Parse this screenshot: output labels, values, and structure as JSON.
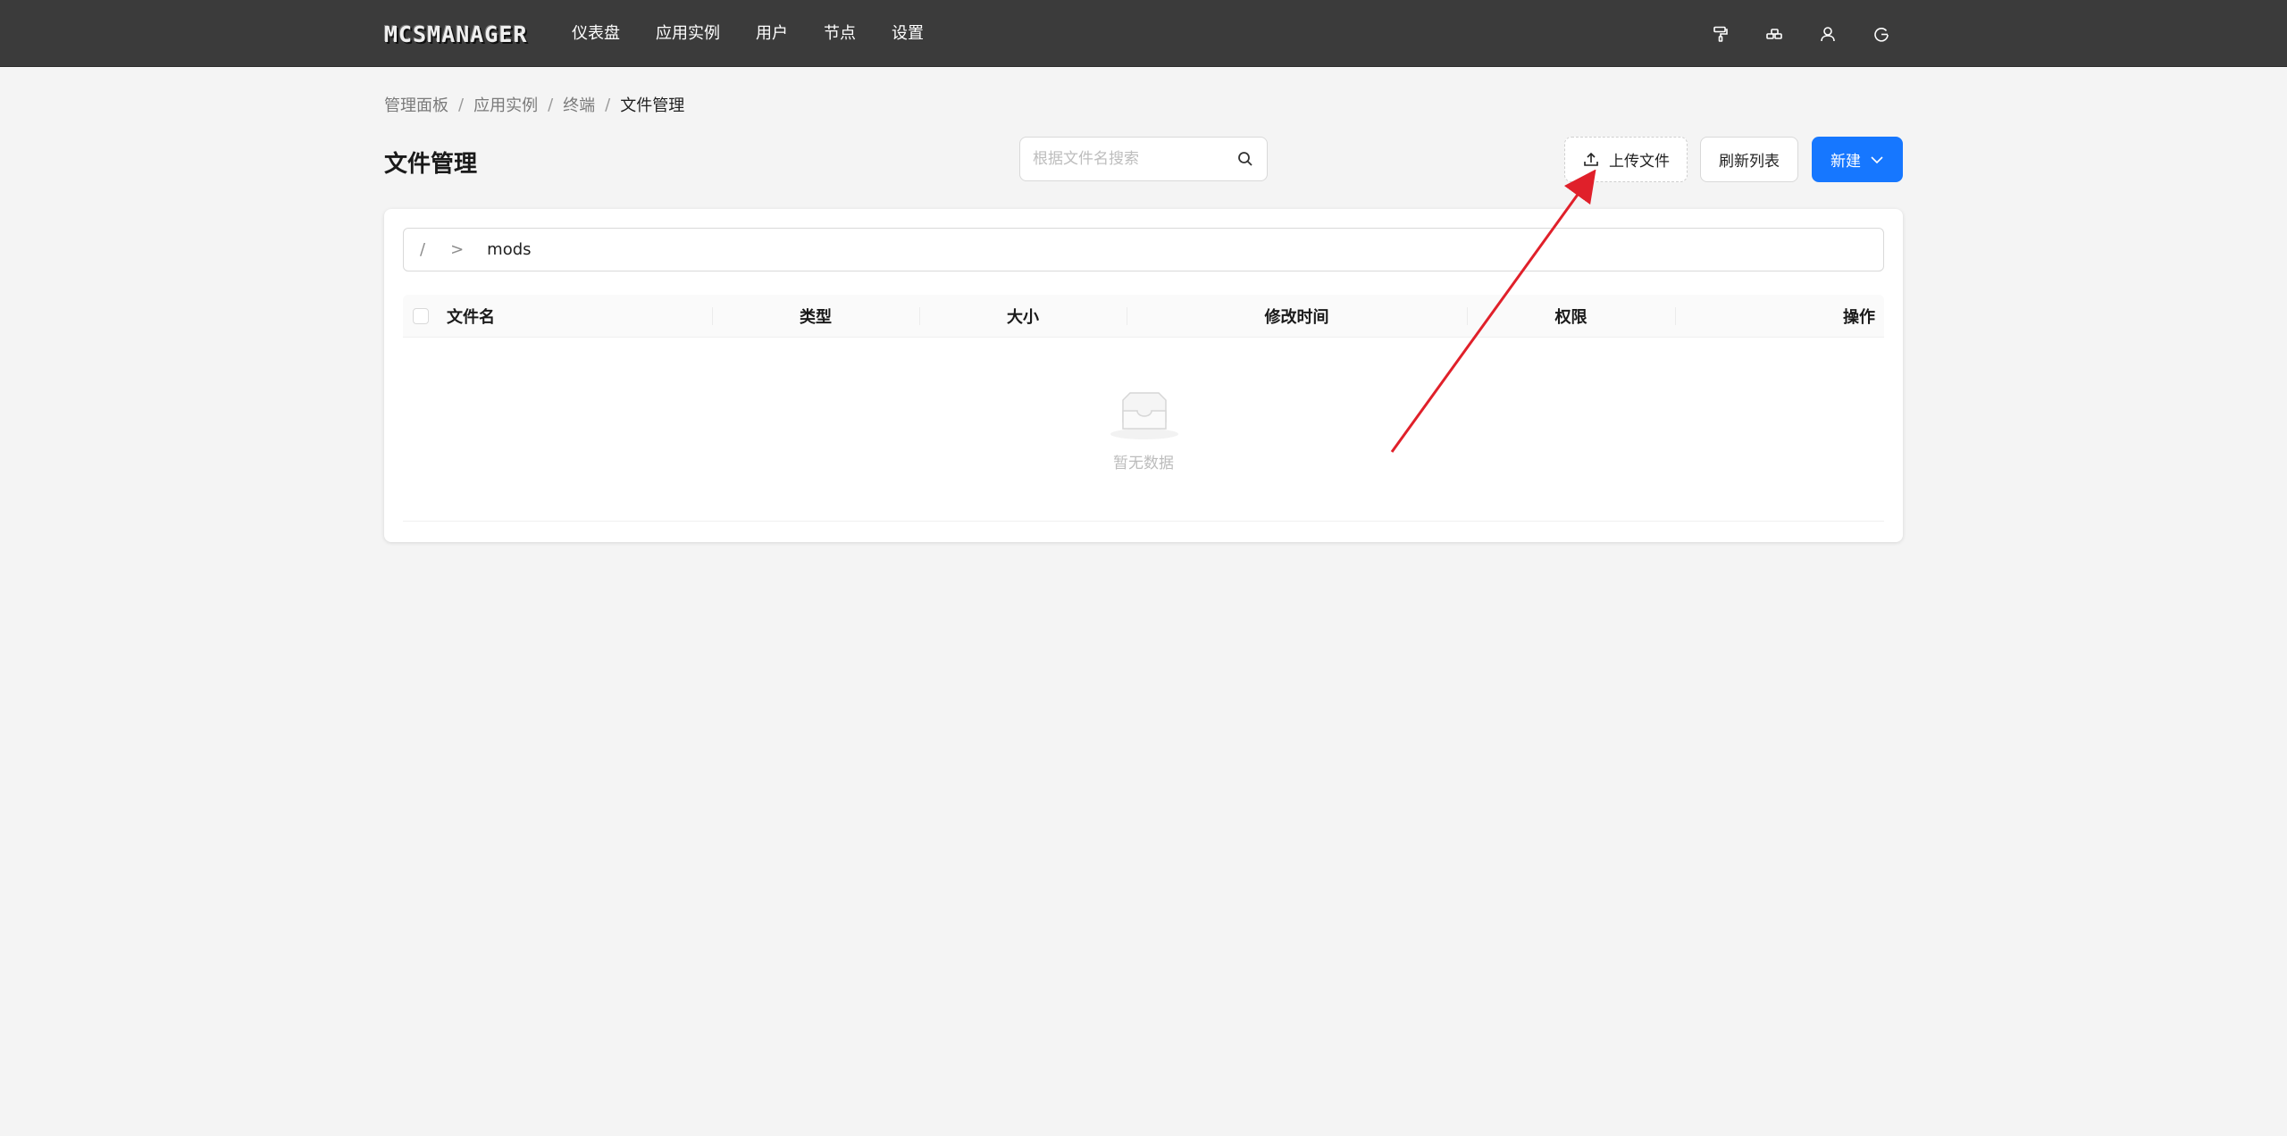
{
  "navbar": {
    "logo": "MCSMANAGER",
    "items": [
      {
        "label": "仪表盘"
      },
      {
        "label": "应用实例"
      },
      {
        "label": "用户"
      },
      {
        "label": "节点"
      },
      {
        "label": "设置"
      }
    ],
    "right_icons": [
      "paint-roller-icon",
      "layout-icon",
      "user-icon",
      "logout-icon"
    ]
  },
  "breadcrumb": {
    "items": [
      "管理面板",
      "应用实例",
      "终端"
    ],
    "current": "文件管理",
    "separator": "/"
  },
  "page": {
    "title": "文件管理"
  },
  "search": {
    "placeholder": "根据文件名搜索",
    "value": ""
  },
  "toolbar": {
    "upload_label": "上传文件",
    "refresh_label": "刷新列表",
    "new_label": "新建"
  },
  "path": {
    "root": "/",
    "separator": ">",
    "segments": [
      "mods"
    ]
  },
  "table": {
    "columns": [
      "文件名",
      "类型",
      "大小",
      "修改时间",
      "权限",
      "操作"
    ],
    "rows": [],
    "empty_text": "暂无数据"
  },
  "colors": {
    "navbar_bg": "#3b3b3b",
    "primary": "#1677ff",
    "page_bg": "#f4f4f4",
    "annotation_arrow": "#e0202a"
  }
}
